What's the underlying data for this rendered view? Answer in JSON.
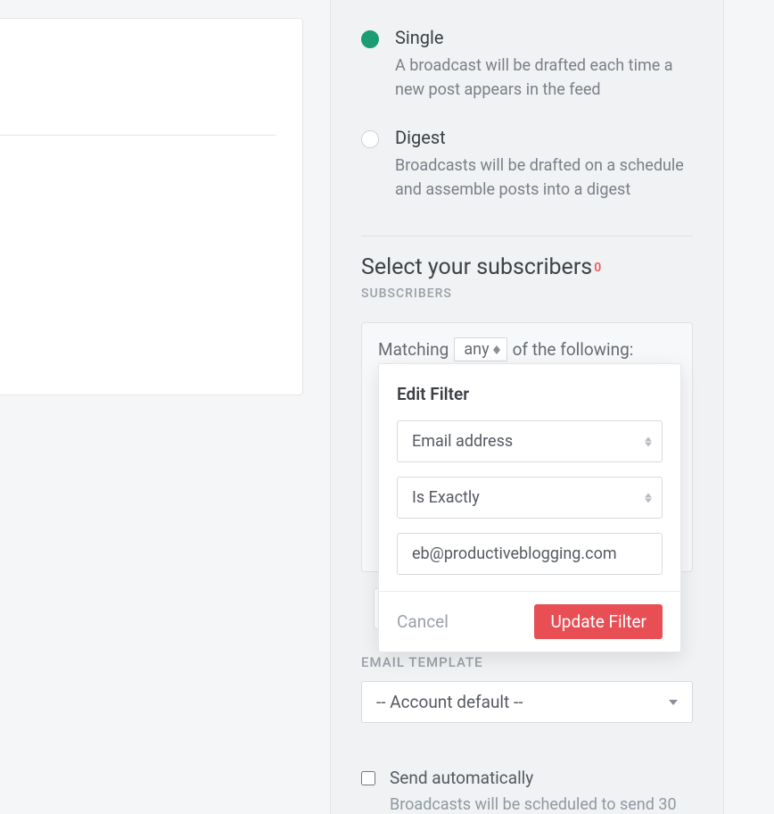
{
  "broadcast_type": {
    "single": {
      "label": "Single",
      "description": "A broadcast will be drafted each time a new post appears in the feed",
      "selected": true
    },
    "digest": {
      "label": "Digest",
      "description": "Broadcasts will be drafted on a schedule and assemble posts into a digest",
      "selected": false
    }
  },
  "subscribers": {
    "heading": "Select your subscribers",
    "count": "0",
    "count_label": " SUBSCRIBERS",
    "matching_pre": "Matching",
    "matching_mode": "any",
    "matching_post": "of the following:"
  },
  "edit_filter": {
    "title": "Edit Filter",
    "field": "Email address",
    "operator": "Is Exactly",
    "value": "eb@productiveblogging.com",
    "cancel": "Cancel",
    "submit": "Update Filter"
  },
  "email_template": {
    "label": "EMAIL TEMPLATE",
    "value": "-- Account default --"
  },
  "send_auto": {
    "label": "Send automatically",
    "description": "Broadcasts will be scheduled to send 30"
  }
}
